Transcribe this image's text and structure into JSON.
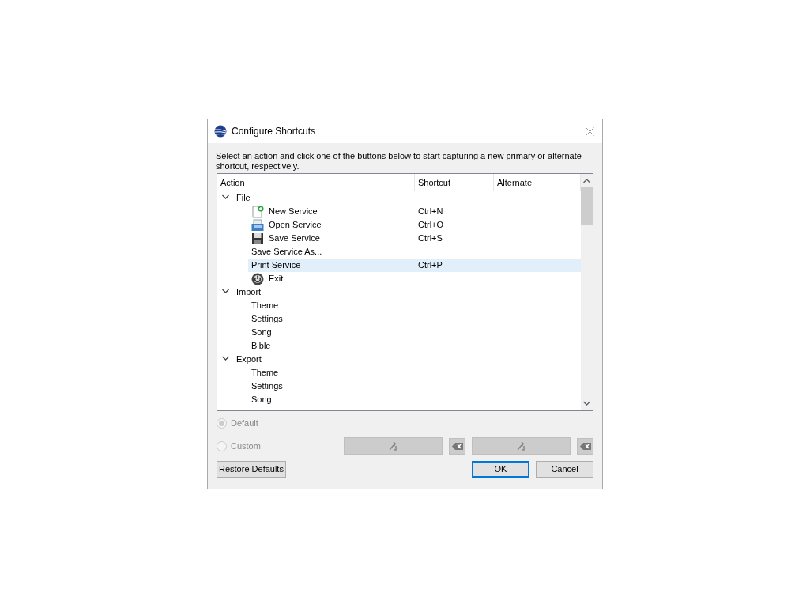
{
  "window": {
    "title": "Configure Shortcuts"
  },
  "instructions": "Select an action and click one of the buttons below to start capturing a new primary or alternate shortcut, respectively.",
  "table": {
    "columns": [
      "Action",
      "Shortcut",
      "Alternate"
    ],
    "rows": [
      {
        "label": "File",
        "expanded": true,
        "children": [
          {
            "label": "New Service",
            "kind": "new",
            "shortcut": "Ctrl+N",
            "selected": false
          },
          {
            "label": "Open Service",
            "kind": "open",
            "shortcut": "Ctrl+O",
            "selected": false
          },
          {
            "label": "Save Service",
            "kind": "save",
            "shortcut": "Ctrl+S",
            "selected": false
          },
          {
            "label": "Save Service As...",
            "selected": false
          },
          {
            "label": "Print Service",
            "shortcut": "Ctrl+P",
            "selected": true
          },
          {
            "label": "Exit",
            "kind": "exit",
            "selected": false
          }
        ]
      },
      {
        "label": "Import",
        "expanded": true,
        "children": [
          {
            "label": "Theme",
            "selected": false
          },
          {
            "label": "Settings",
            "selected": false
          },
          {
            "label": "Song",
            "selected": false
          },
          {
            "label": "Bible",
            "selected": false
          }
        ]
      },
      {
        "label": "Export",
        "expanded": true,
        "children": [
          {
            "label": "Theme",
            "selected": false
          },
          {
            "label": "Settings",
            "selected": false
          },
          {
            "label": "Song",
            "selected": false
          }
        ]
      }
    ]
  },
  "options": [
    {
      "label": "Default",
      "selected": true,
      "disabled": true
    },
    {
      "label": "Custom",
      "selected": false,
      "disabled": true
    }
  ],
  "buttons": {
    "restore": "Restore Defaults",
    "ok": "OK",
    "cancel": "Cancel"
  }
}
